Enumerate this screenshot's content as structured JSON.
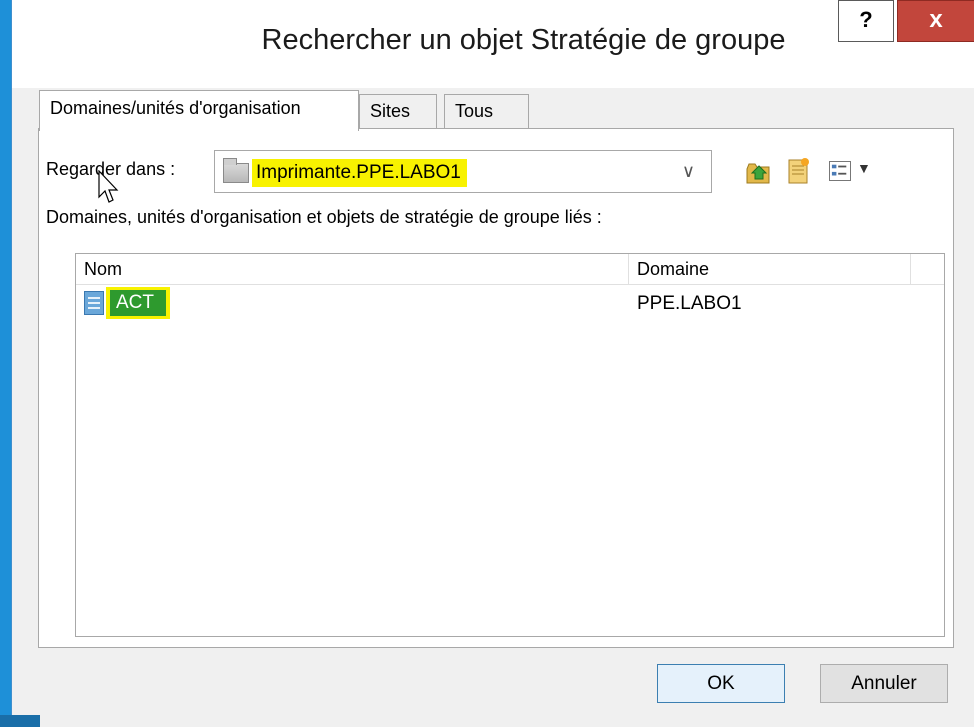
{
  "dialog": {
    "title": "Rechercher un objet Stratégie de groupe",
    "help_label": "?",
    "close_label": "x"
  },
  "tabs": [
    {
      "label": "Domaines/unités d'organisation",
      "active": true
    },
    {
      "label": "Sites",
      "active": false
    },
    {
      "label": "Tous",
      "active": false
    }
  ],
  "look_in": {
    "label": "Regarder dans :",
    "value": "Imprimante.PPE.LABO1"
  },
  "list_label": "Domaines, unités d'organisation et objets de stratégie de groupe liés :",
  "table": {
    "columns": [
      "Nom",
      "Domaine"
    ],
    "rows": [
      {
        "name": "ACT",
        "domain": "PPE.LABO1"
      }
    ]
  },
  "buttons": {
    "ok": "OK",
    "cancel": "Annuler"
  },
  "colors": {
    "highlight": "#f8f200",
    "selection": "#2e9a2e",
    "close_button": "#c2463c",
    "window_frame": "#1e90d8"
  }
}
